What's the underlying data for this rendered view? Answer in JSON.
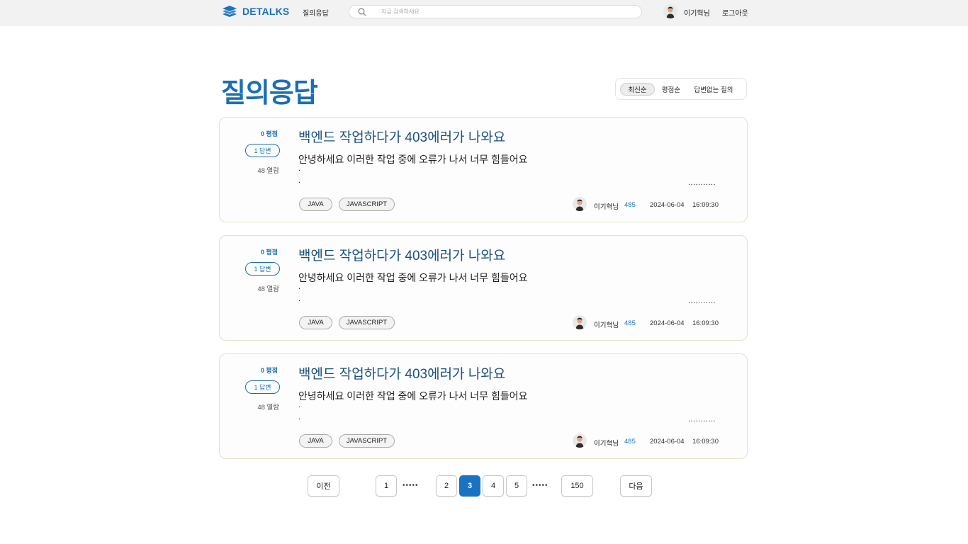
{
  "header": {
    "logo_text": "DETALKS",
    "nav_qna": "질의응답",
    "search_placeholder": "지금 검색하세요",
    "user_name": "이기혁님",
    "logout": "로그아웃"
  },
  "page": {
    "title": "질의응답",
    "sort_options": [
      "최신순",
      "평점순",
      "답변없는 질의"
    ],
    "active_sort": "최신순"
  },
  "questions": [
    {
      "score": "0 평점",
      "answers": "1 답변",
      "views": "48 열람",
      "title": "백엔드 작업하다가 403에러가 나와요",
      "body": "안녕하세요 이러한 작업 중에 오류가 나서 너무 힘들어요",
      "dot1": ".",
      "dot2": ".",
      "ellipsis": "...........",
      "tags": [
        "JAVA",
        "JAVASCRIPT"
      ],
      "author": "이기혁님",
      "author_score": "485",
      "date": "2024-06-04",
      "time": "16:09:30"
    },
    {
      "score": "0 평점",
      "answers": "1 답변",
      "views": "48 열람",
      "title": "백엔드 작업하다가 403에러가 나와요",
      "body": "안녕하세요 이러한 작업 중에 오류가 나서 너무 힘들어요",
      "dot1": ".",
      "dot2": ".",
      "ellipsis": "...........",
      "tags": [
        "JAVA",
        "JAVASCRIPT"
      ],
      "author": "이기혁님",
      "author_score": "485",
      "date": "2024-06-04",
      "time": "16:09:30"
    },
    {
      "score": "0 평점",
      "answers": "1 답변",
      "views": "48 열람",
      "title": "백엔드 작업하다가 403에러가 나와요",
      "body": "안녕하세요 이러한 작업 중에 오류가 나서 너무 힘들어요",
      "dot1": ".",
      "dot2": ".",
      "ellipsis": "...........",
      "tags": [
        "JAVA",
        "JAVASCRIPT"
      ],
      "author": "이기혁님",
      "author_score": "485",
      "date": "2024-06-04",
      "time": "16:09:30"
    }
  ],
  "pagination": {
    "prev": "이전",
    "next": "다음",
    "pages": [
      "1",
      "2",
      "3",
      "4",
      "5",
      "150"
    ],
    "dots": "•••••",
    "current": "3"
  },
  "colors": {
    "accent": "#1a73c2",
    "title_blue": "#1a6fb5",
    "card_border": "#e6e0c8",
    "header_bg": "#f2f2f2"
  },
  "icons": {
    "logo": "detalks-logo-icon",
    "search": "search-icon",
    "avatar": "user-avatar-icon"
  }
}
